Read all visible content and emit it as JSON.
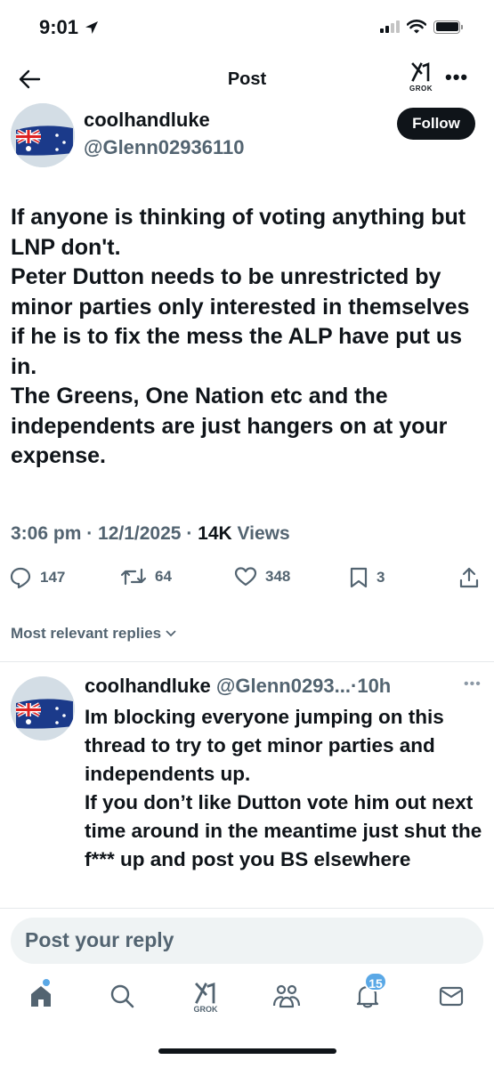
{
  "status_bar": {
    "time": "9:01"
  },
  "header": {
    "title": "Post",
    "grok_label": "GROK"
  },
  "author": {
    "name": "coolhandluke",
    "handle": "@Glenn02936110",
    "follow_label": "Follow"
  },
  "post": {
    "lines": [
      "If anyone is thinking of voting anything but LNP don't.",
      "Peter Dutton needs to be unrestricted by minor parties only interested in themselves if he is to fix the mess the ALP have put us in.",
      "The Greens, One Nation etc and the independents are just hangers on at your expense."
    ],
    "time": "3:06 pm",
    "date": "12/1/2025",
    "views_count": "14K",
    "views_label": "Views"
  },
  "actions": {
    "replies": "147",
    "reposts": "64",
    "likes": "348",
    "bookmarks": "3"
  },
  "sort_label": "Most relevant replies",
  "reply": {
    "name": "coolhandluke",
    "handle": "@Glenn0293...",
    "time": "10h",
    "lines": [
      "Im blocking everyone jumping on this thread to try to get minor parties and independents up.",
      "If you don’t like Dutton vote him out next time around in the meantime just shut the f*** up and post you BS elsewhere"
    ]
  },
  "reply_box": {
    "placeholder": "Post your reply"
  },
  "bottom_nav": {
    "grok_label": "GROK",
    "notifications_badge": "15"
  },
  "colors": {
    "text": "#0f1419",
    "secondary": "#536471",
    "badge": "#5aa8e6",
    "reply_bg": "#eff3f4"
  }
}
